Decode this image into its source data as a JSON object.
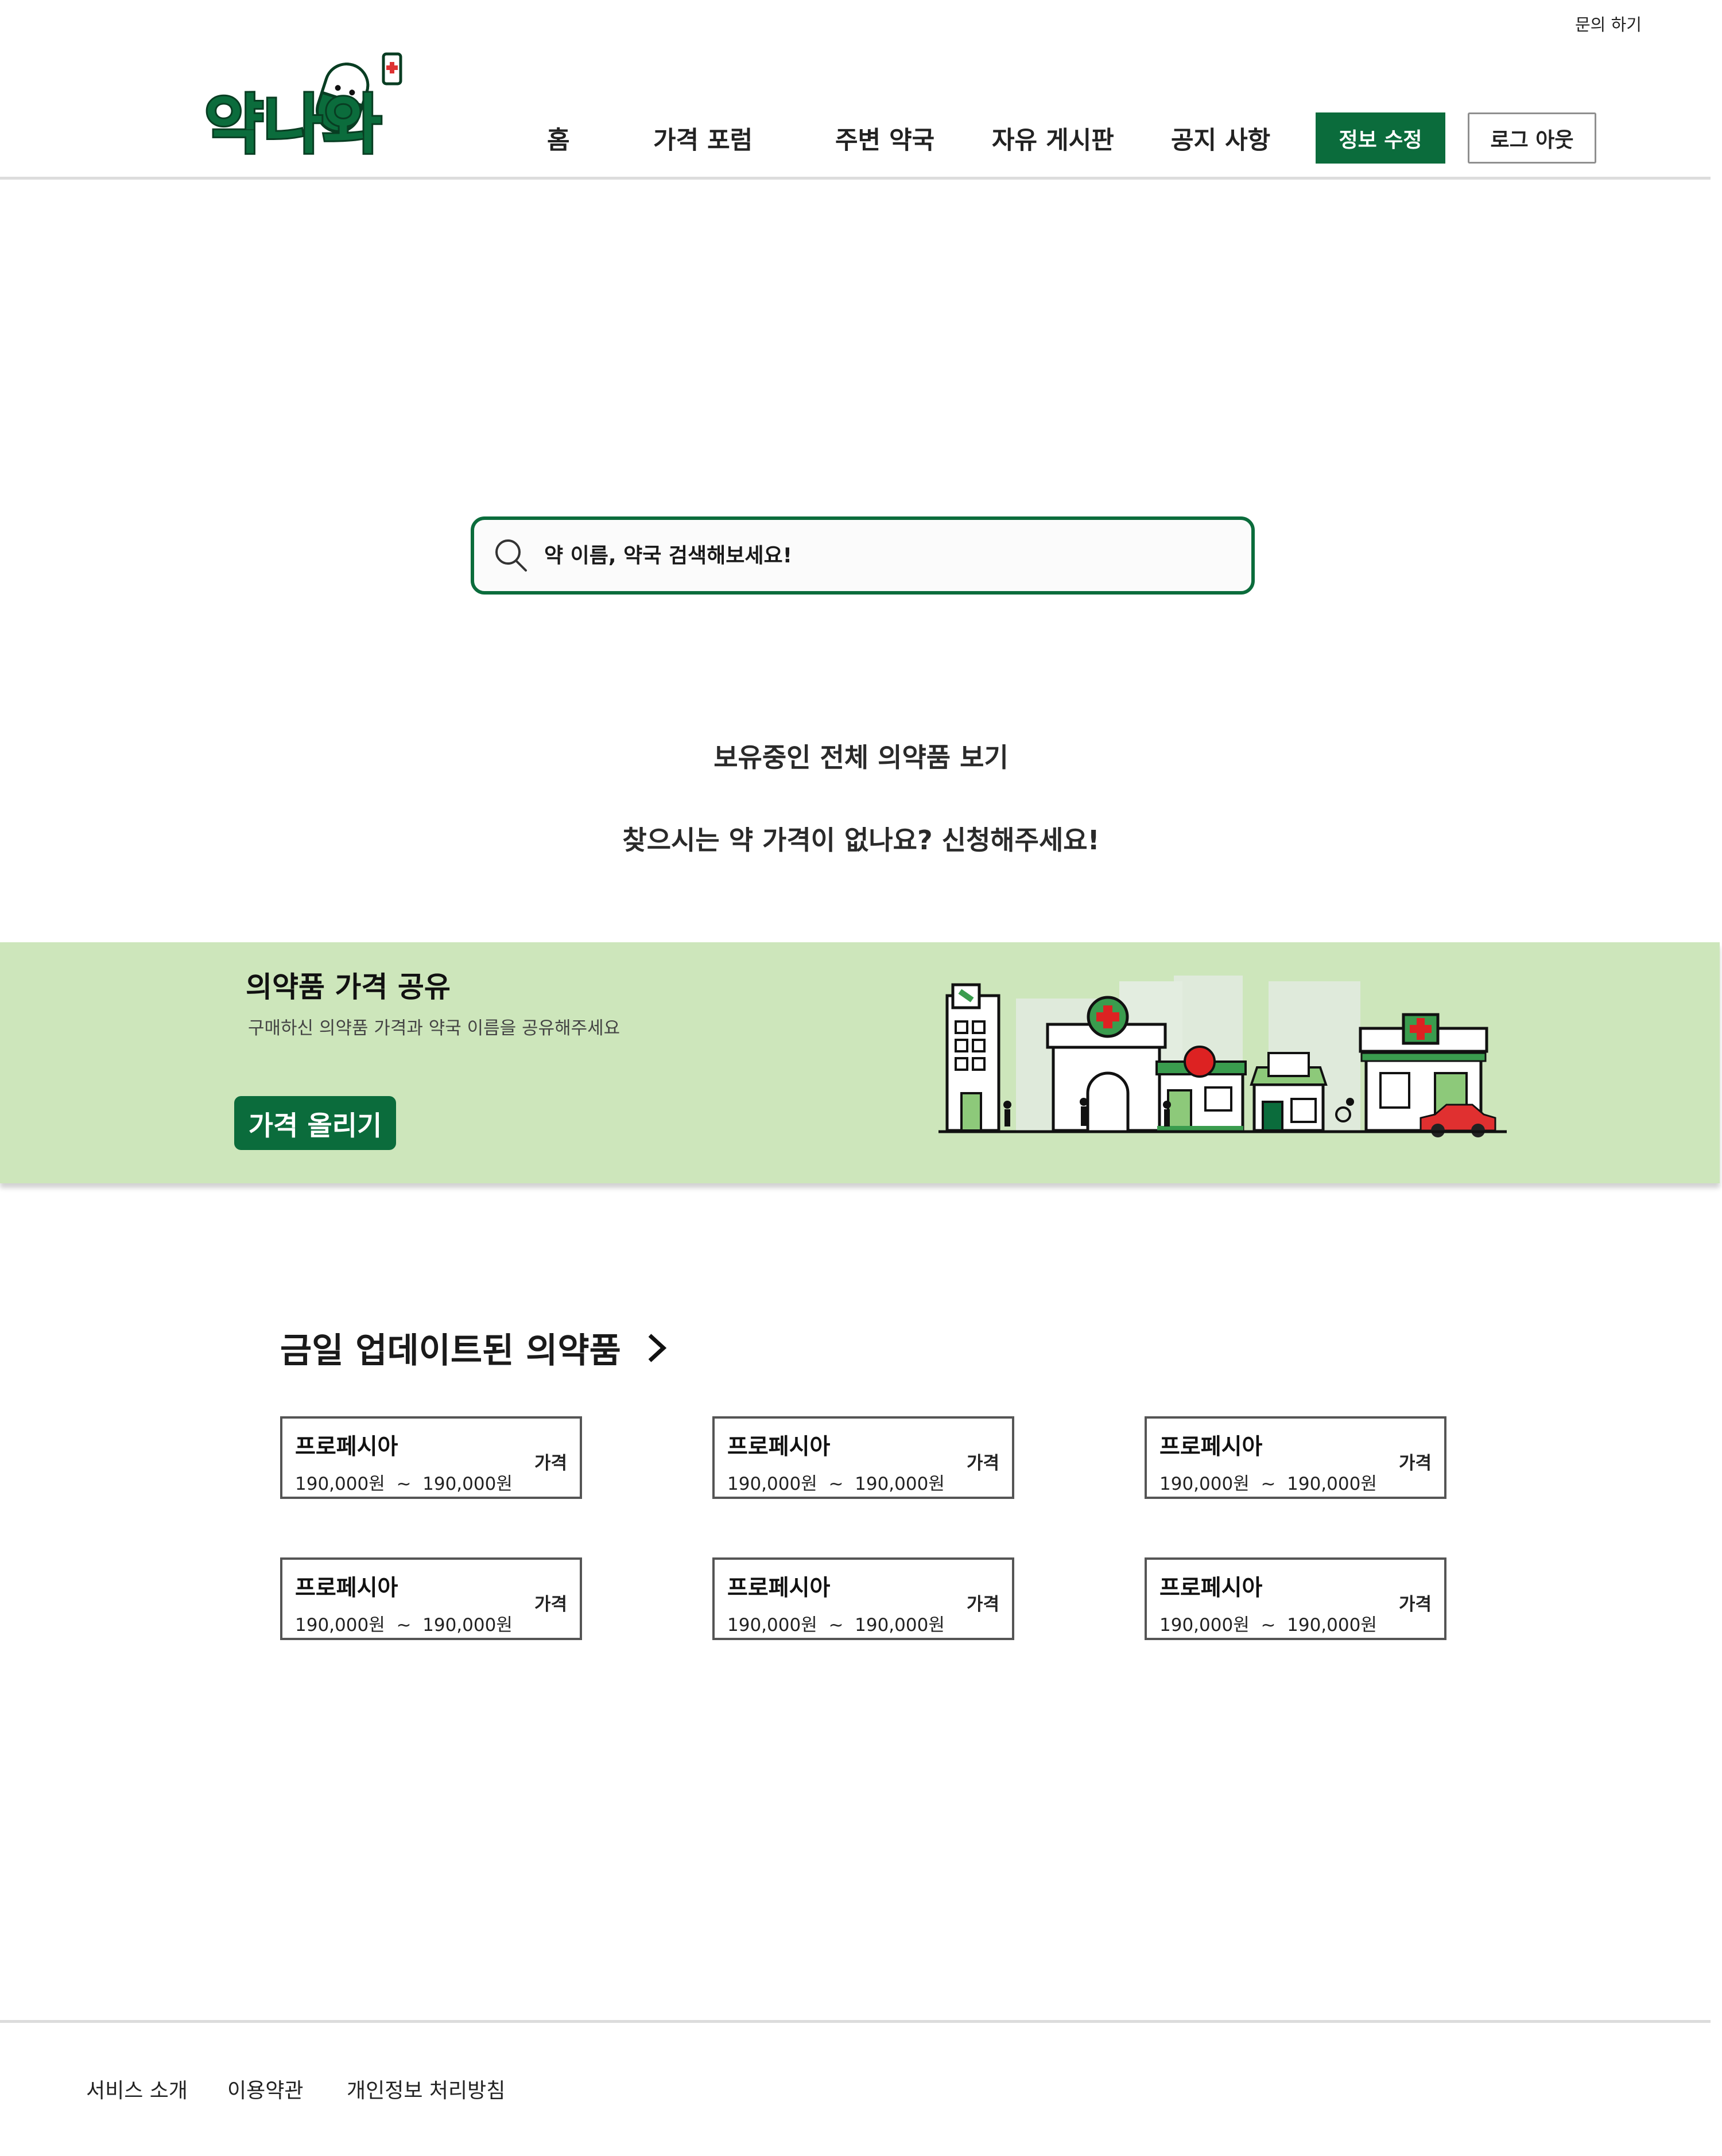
{
  "header": {
    "inquiry": "문의 하기",
    "logo_text": "약나와",
    "nav": [
      "홈",
      "가격 포럼",
      "주변 약국",
      "자유 게시판",
      "공지 사항"
    ],
    "edit_profile": "정보 수정",
    "logout": "로그 아웃"
  },
  "search": {
    "placeholder": "약 이름, 약국 검색해보세요!"
  },
  "links": {
    "view_all": "보유중인 전체 의약품 보기",
    "request": "찾으시는 약 가격이 없나요? 신청해주세요!"
  },
  "banner": {
    "title": "의약품 가격 공유",
    "subtitle": "구매하신 의약품 가격과 약국 이름을 공유해주세요",
    "button": "가격 올리기"
  },
  "updated": {
    "title": "금일 업데이트된 의약품",
    "items": [
      {
        "name": "프로페시아",
        "min": "190,000원",
        "sep": "~",
        "max": "190,000원",
        "tag": "가격"
      },
      {
        "name": "프로페시아",
        "min": "190,000원",
        "sep": "~",
        "max": "190,000원",
        "tag": "가격"
      },
      {
        "name": "프로페시아",
        "min": "190,000원",
        "sep": "~",
        "max": "190,000원",
        "tag": "가격"
      },
      {
        "name": "프로페시아",
        "min": "190,000원",
        "sep": "~",
        "max": "190,000원",
        "tag": "가격"
      },
      {
        "name": "프로페시아",
        "min": "190,000원",
        "sep": "~",
        "max": "190,000원",
        "tag": "가격"
      },
      {
        "name": "프로페시아",
        "min": "190,000원",
        "sep": "~",
        "max": "190,000원",
        "tag": "가격"
      }
    ]
  },
  "footer": {
    "links": [
      "서비스 소개",
      "이용약관",
      "개인정보 처리방침"
    ]
  },
  "colors": {
    "brand_green": "#0b6c3c",
    "banner_bg": "#cde6bb"
  }
}
